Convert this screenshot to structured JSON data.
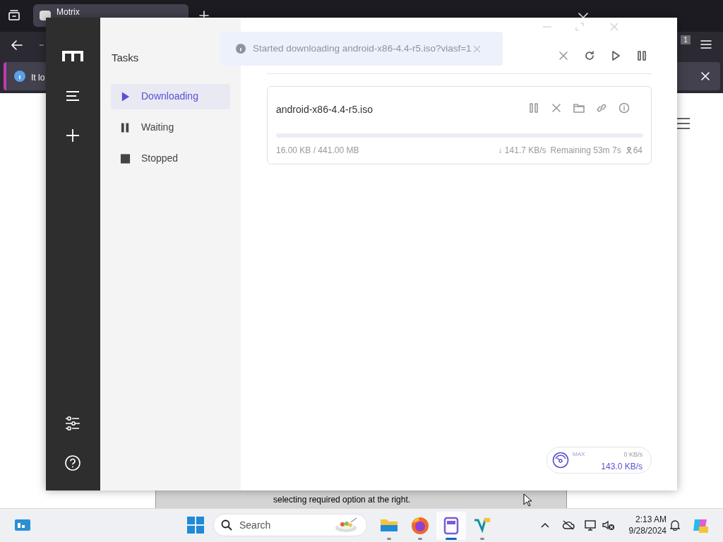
{
  "browser": {
    "tab_title": "Motrix",
    "info_bar_text": "It lo",
    "extension_badge": "1",
    "background_dialog_text": "selecting required option at the right."
  },
  "app": {
    "panel_title": "Tasks",
    "categories": [
      {
        "kind": "play",
        "label": "Downloading",
        "selected": true
      },
      {
        "kind": "pause",
        "label": "Waiting",
        "selected": false
      },
      {
        "kind": "stop",
        "label": "Stopped",
        "selected": false
      }
    ],
    "toast": {
      "text": "Started downloading android-x86-4.4-r5.iso?viasf=1"
    },
    "tasks": [
      {
        "name": "android-x86-4.4-r5.iso",
        "level": 0.0001,
        "size": "16.00 KB / 441.00 MB",
        "speed": "↓ 141.7 KB/s",
        "remaining": "Remaining 53m 7s",
        "connections": "64"
      }
    ],
    "speedometer": {
      "label": "MAX",
      "limit": "0 KB/s",
      "speed": "143.0 KB/s"
    }
  },
  "taskbar": {
    "search_placeholder": "Search",
    "apps": [
      {
        "kind": "folder",
        "selected": false
      },
      {
        "kind": "firefox",
        "selected": false
      },
      {
        "kind": "motrix",
        "selected": true
      },
      {
        "kind": "vs",
        "selected": false
      }
    ],
    "time": "2:13 AM",
    "date": "9/28/2024"
  }
}
